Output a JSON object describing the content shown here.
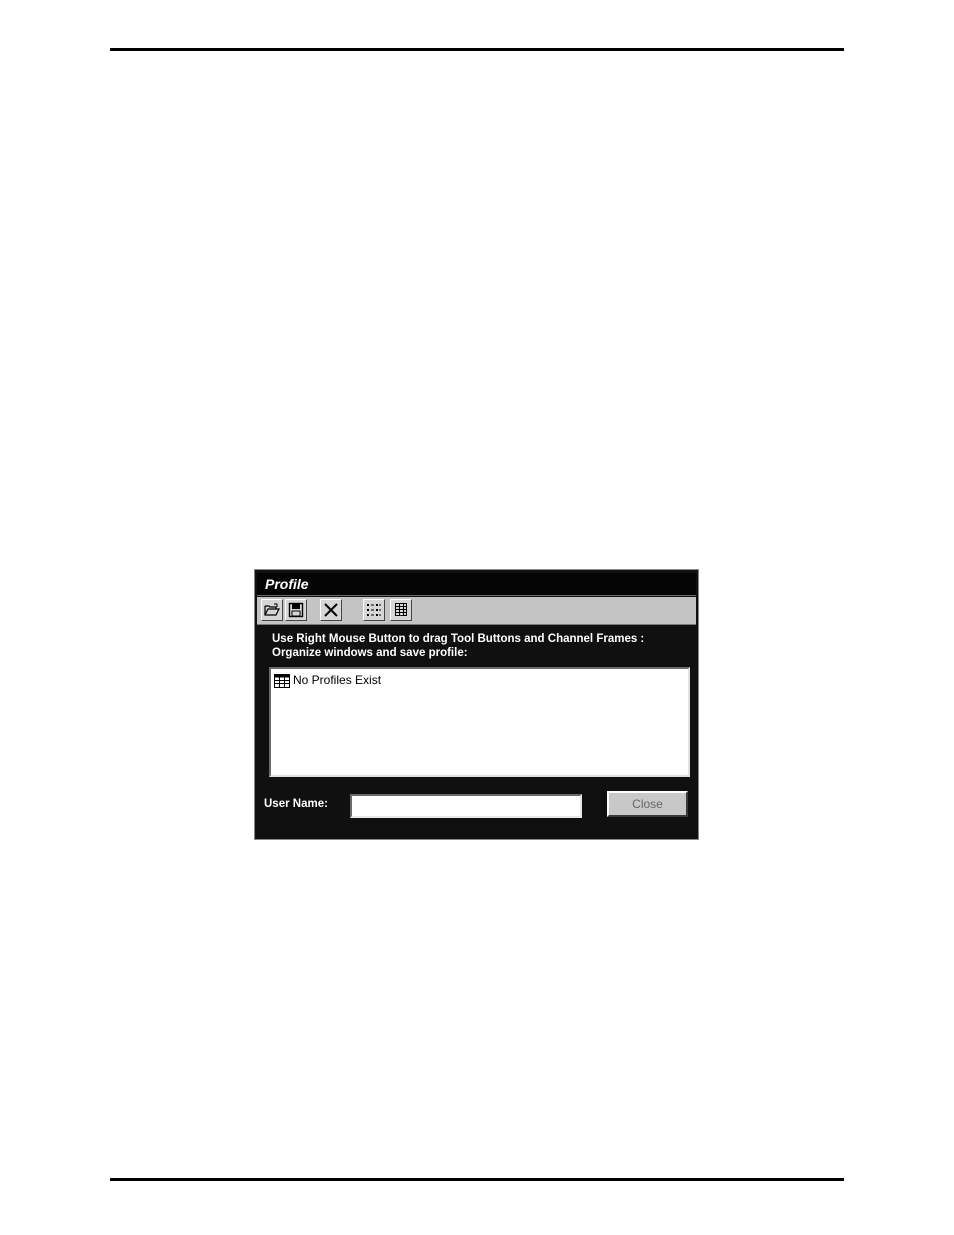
{
  "window": {
    "title": "Profile"
  },
  "toolbar": {
    "buttons": [
      {
        "name": "open-profile-button",
        "icon": "folder-open-icon"
      },
      {
        "name": "save-profile-button",
        "icon": "floppy-disk-icon"
      },
      {
        "name": "delete-profile-button",
        "icon": "x-icon"
      },
      {
        "name": "list-view-button",
        "icon": "list-view-icon"
      },
      {
        "name": "details-view-button",
        "icon": "details-view-icon"
      }
    ]
  },
  "instructions": {
    "line1": "Use Right Mouse Button to drag Tool Buttons and Channel Frames :",
    "line2": "Organize windows and save profile:"
  },
  "profiles": {
    "items": [
      {
        "label": "No Profiles Exist",
        "icon": "table-icon"
      }
    ]
  },
  "user_name": {
    "label": "User Name:",
    "value": ""
  },
  "close_button": {
    "label": "Close",
    "enabled": false
  }
}
